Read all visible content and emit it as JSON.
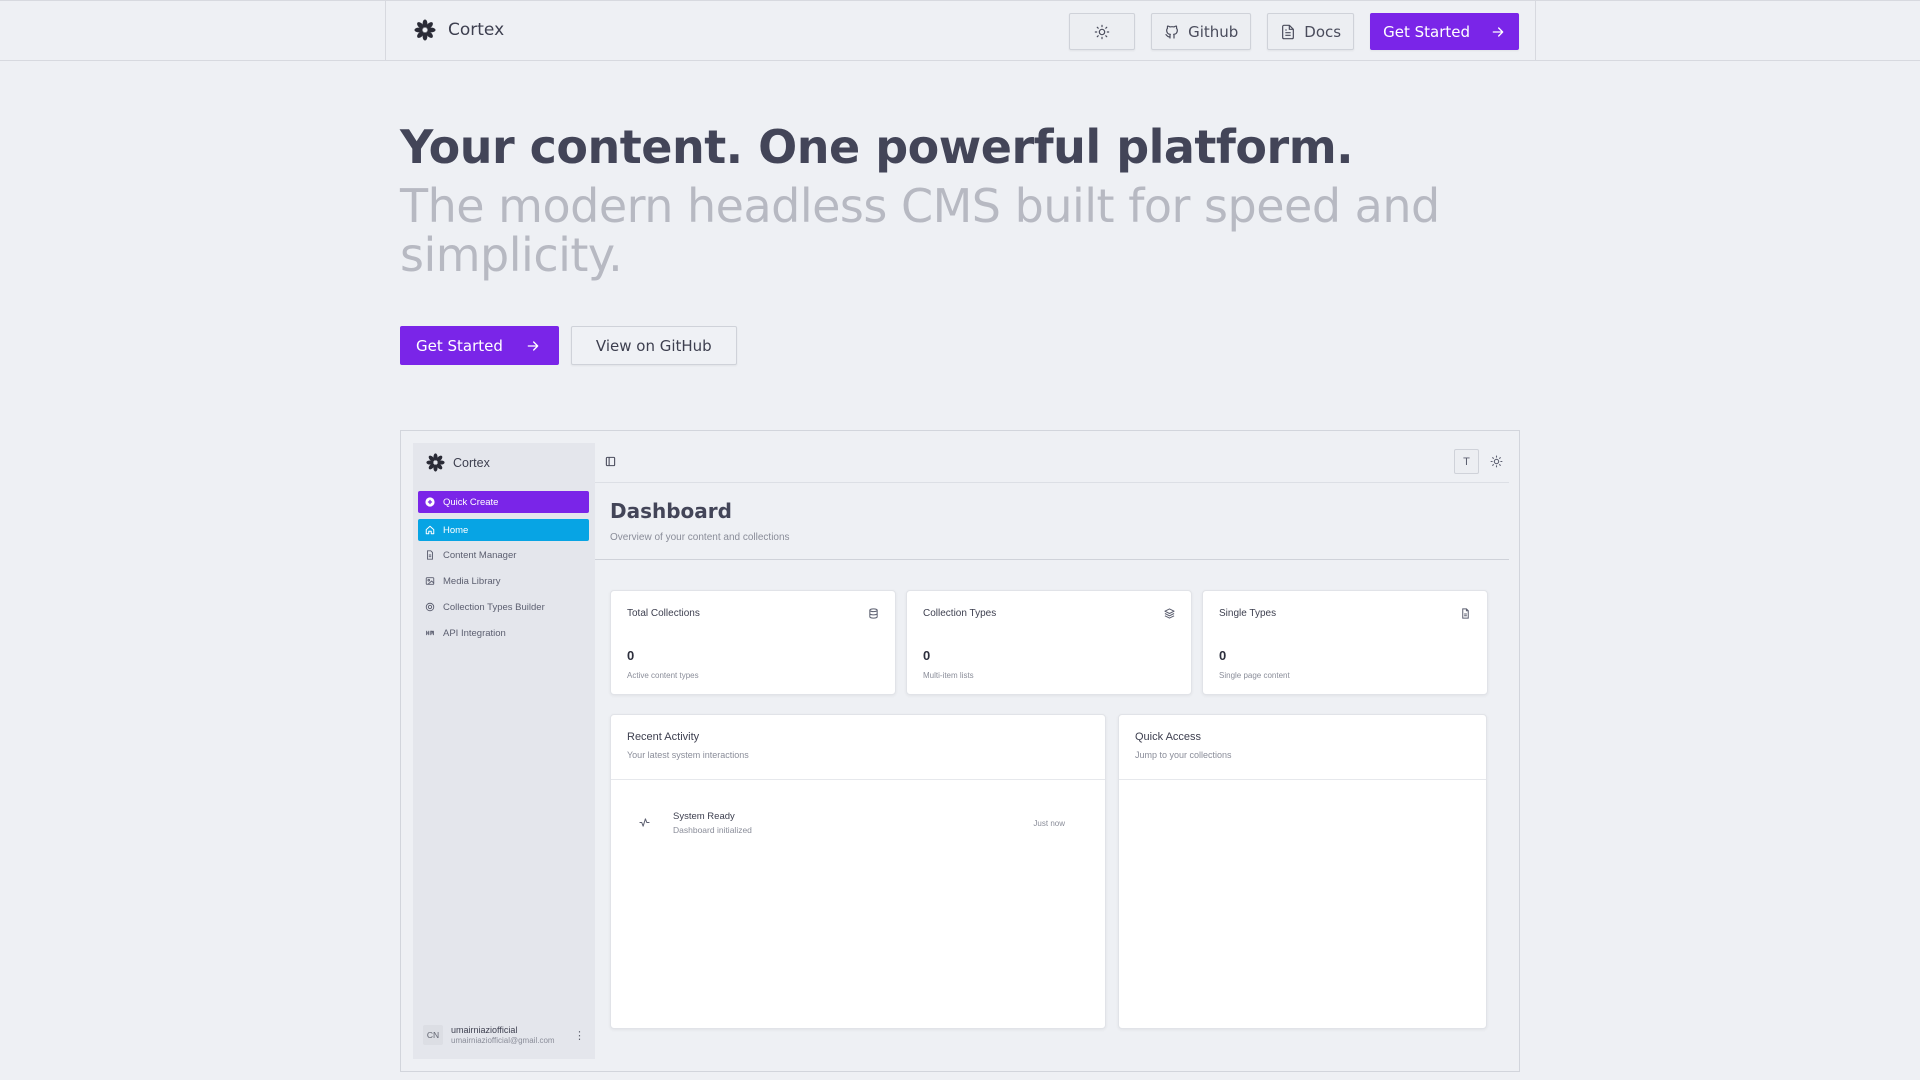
{
  "nav": {
    "brand": "Cortex",
    "github": "Github",
    "docs": "Docs",
    "get_started": "Get Started"
  },
  "hero": {
    "headline": "Your content. One powerful platform.",
    "subline": "The modern headless CMS built for speed and simplicity.",
    "cta_primary": "Get Started",
    "cta_secondary": "View on GitHub"
  },
  "preview": {
    "sidebar": {
      "brand": "Cortex",
      "items": [
        {
          "label": "Quick Create",
          "icon": "plus-circle-icon"
        },
        {
          "label": "Home",
          "icon": "home-icon"
        },
        {
          "label": "Content Manager",
          "icon": "file-icon"
        },
        {
          "label": "Media Library",
          "icon": "image-icon"
        },
        {
          "label": "Collection Types Builder",
          "icon": "settings-icon"
        },
        {
          "label": "API Integration",
          "icon": "link-icon"
        }
      ],
      "user": {
        "initials": "CN",
        "name": "umairniaziofficial",
        "email": "umairniaziofficial@gmail.com"
      }
    },
    "topbar": {
      "font_button": "T"
    },
    "dashboard": {
      "title": "Dashboard",
      "subtitle": "Overview of your content and collections"
    },
    "stats": [
      {
        "title": "Total Collections",
        "value": "0",
        "desc": "Active content types",
        "icon": "database-icon"
      },
      {
        "title": "Collection Types",
        "value": "0",
        "desc": "Multi-item lists",
        "icon": "layers-icon"
      },
      {
        "title": "Single Types",
        "value": "0",
        "desc": "Single page content",
        "icon": "file-icon"
      }
    ],
    "recent": {
      "title": "Recent Activity",
      "subtitle": "Your latest system interactions",
      "activity": {
        "title": "System Ready",
        "desc": "Dashboard initialized",
        "time": "Just now"
      }
    },
    "quick": {
      "title": "Quick Access",
      "subtitle": "Jump to your collections"
    }
  },
  "colors": {
    "primary": "#7a25e8",
    "home_active": "#07a4e4",
    "background": "#eef0f4"
  }
}
